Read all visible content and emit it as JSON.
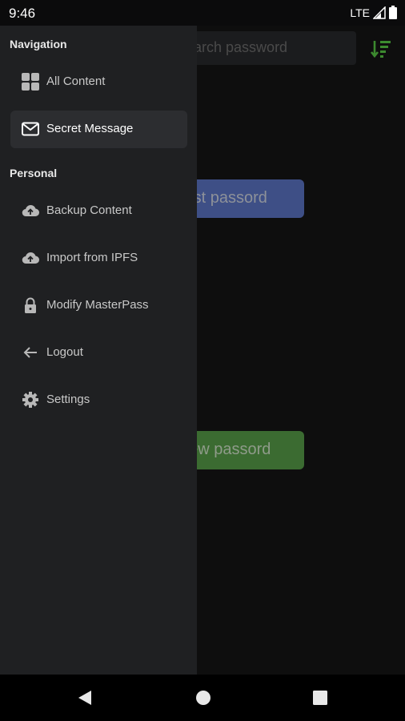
{
  "status_bar": {
    "time": "9:46",
    "network": "LTE"
  },
  "background": {
    "search_placeholder": "Search password",
    "search_visible_text": "word",
    "blue_button_label": "List passord",
    "blue_button_visible_text": "st passord",
    "green_button_label": "New passord",
    "green_button_visible_text": "w passord",
    "colors": {
      "blue": "#3e4f86",
      "green": "#3b6b31",
      "sort_icon": "#3c8a2f"
    }
  },
  "drawer": {
    "sections": [
      {
        "title": "Navigation",
        "items": [
          {
            "label": "All Content",
            "icon": "grid-icon",
            "active": false
          },
          {
            "label": "Secret Message",
            "icon": "mail-icon",
            "active": true
          }
        ]
      },
      {
        "title": "Personal",
        "items": [
          {
            "label": "Backup Content",
            "icon": "cloud-upload-icon",
            "active": false
          },
          {
            "label": "Import from IPFS",
            "icon": "cloud-upload-icon",
            "active": false
          },
          {
            "label": "Modify MasterPass",
            "icon": "lock-icon",
            "active": false
          },
          {
            "label": "Logout",
            "icon": "arrow-left-icon",
            "active": false
          },
          {
            "label": "Settings",
            "icon": "gear-icon",
            "active": false
          }
        ]
      }
    ],
    "colors": {
      "background": "#1f2022",
      "active_item": "#2c2d30"
    }
  },
  "nav_bar": {
    "icons": [
      "back-icon",
      "home-icon",
      "recents-icon"
    ]
  }
}
